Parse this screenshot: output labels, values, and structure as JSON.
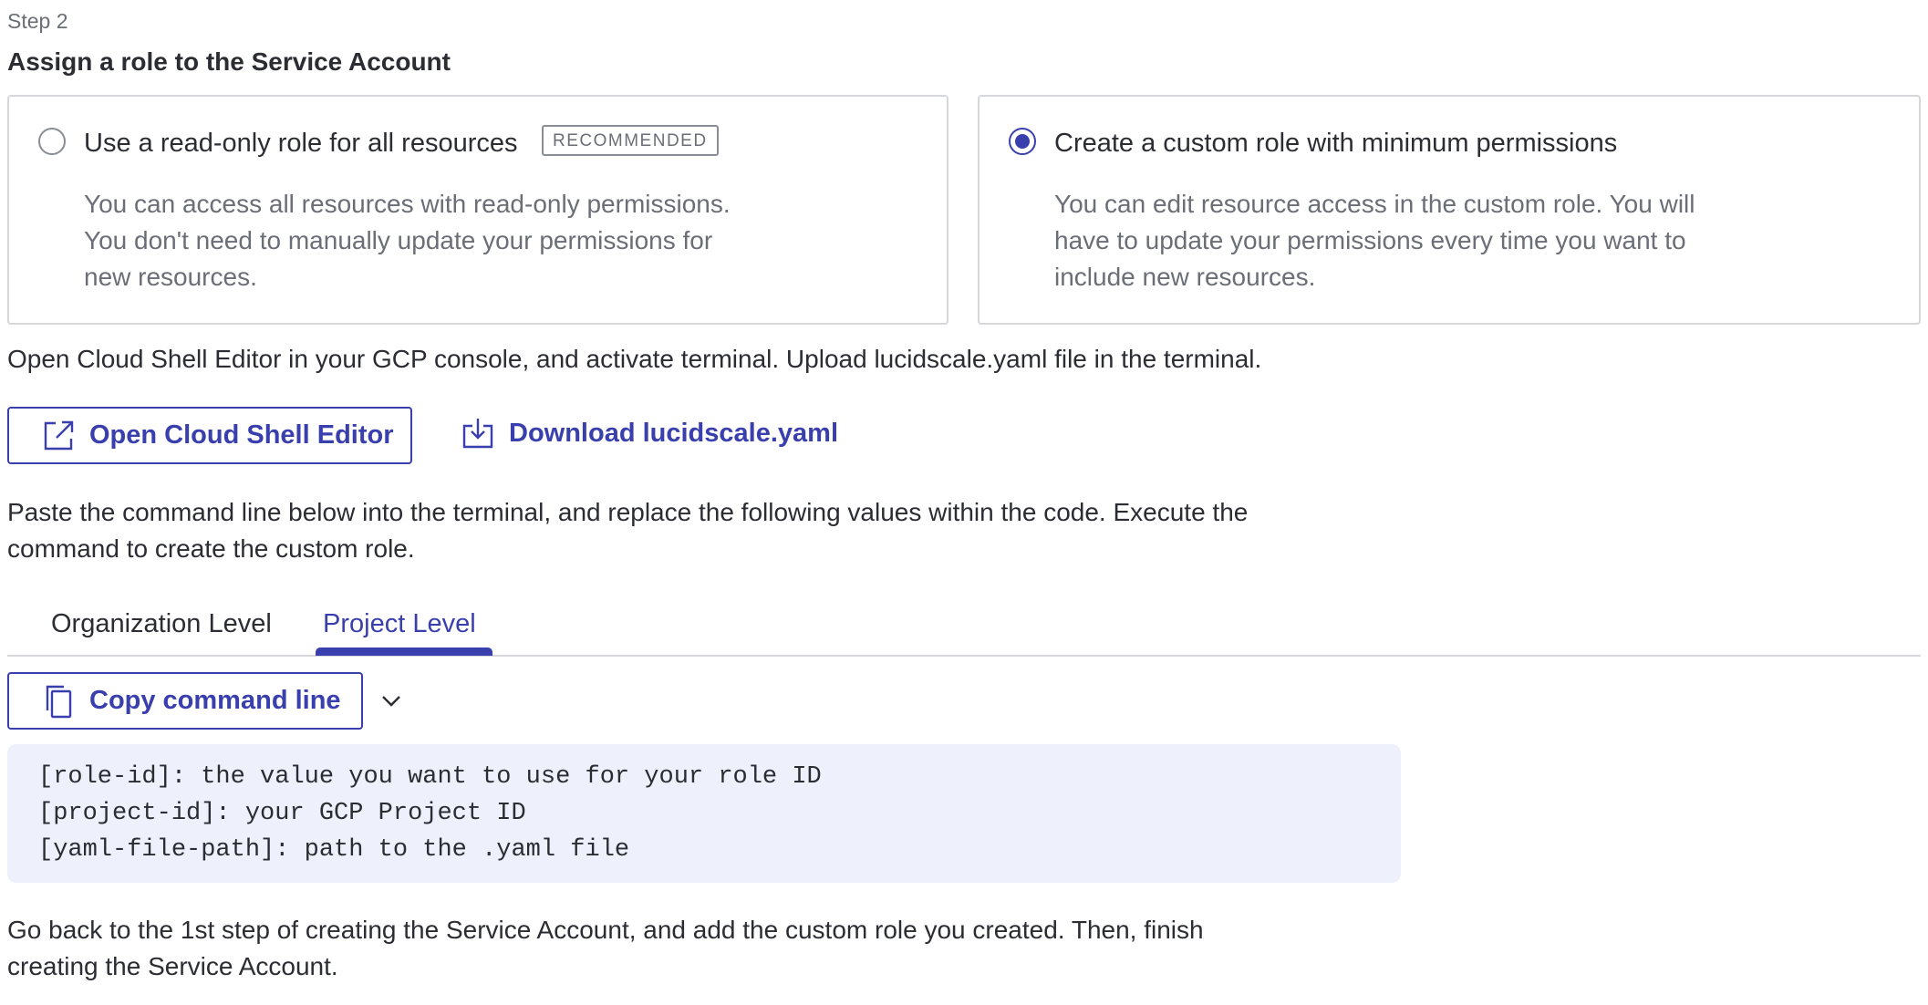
{
  "step": {
    "label": "Step 2",
    "title": "Assign a role to the Service Account"
  },
  "options": [
    {
      "title": "Use a read-only role for all resources",
      "badge": "RECOMMENDED",
      "description": "You can access all resources with read-only permissions.\nYou don't need to manually update your permissions for\nnew resources.",
      "selected": false
    },
    {
      "title": "Create a custom role with minimum permissions",
      "description": "You can edit resource access in the custom role. You will\nhave to update your permissions every time you want to\ninclude new resources.",
      "selected": true
    }
  ],
  "instructions": {
    "open_shell": "Open Cloud Shell Editor in your GCP console, and activate terminal. Upload lucidscale.yaml file in the terminal.",
    "paste_command": "Paste the command line below into the terminal, and replace the following values within the code. Execute the\ncommand to create the custom role.",
    "go_back": "Go back to the 1st step of creating the Service Account, and add the custom role you created. Then, finish\ncreating the Service Account."
  },
  "buttons": {
    "open_shell_label": "Open Cloud Shell Editor",
    "download_label": "Download lucidscale.yaml",
    "copy_label": "Copy command line"
  },
  "tabs": [
    {
      "label": "Organization Level",
      "active": false
    },
    {
      "label": "Project Level",
      "active": true
    }
  ],
  "code": {
    "lines": [
      "[role-id]: the value you want to use for your role ID",
      "[project-id]: your GCP Project ID",
      "[yaml-file-path]: path to the .yaml file"
    ]
  },
  "icons": {
    "external_link": "external-link-icon",
    "download": "download-icon",
    "copy": "copy-icon",
    "chevron": "chevron-down-icon"
  },
  "colors": {
    "accent": "#3a3fae",
    "text": "#2b2d33",
    "muted": "#6b6e76",
    "border": "#d6d7db",
    "code_bg": "#eef0fb"
  }
}
